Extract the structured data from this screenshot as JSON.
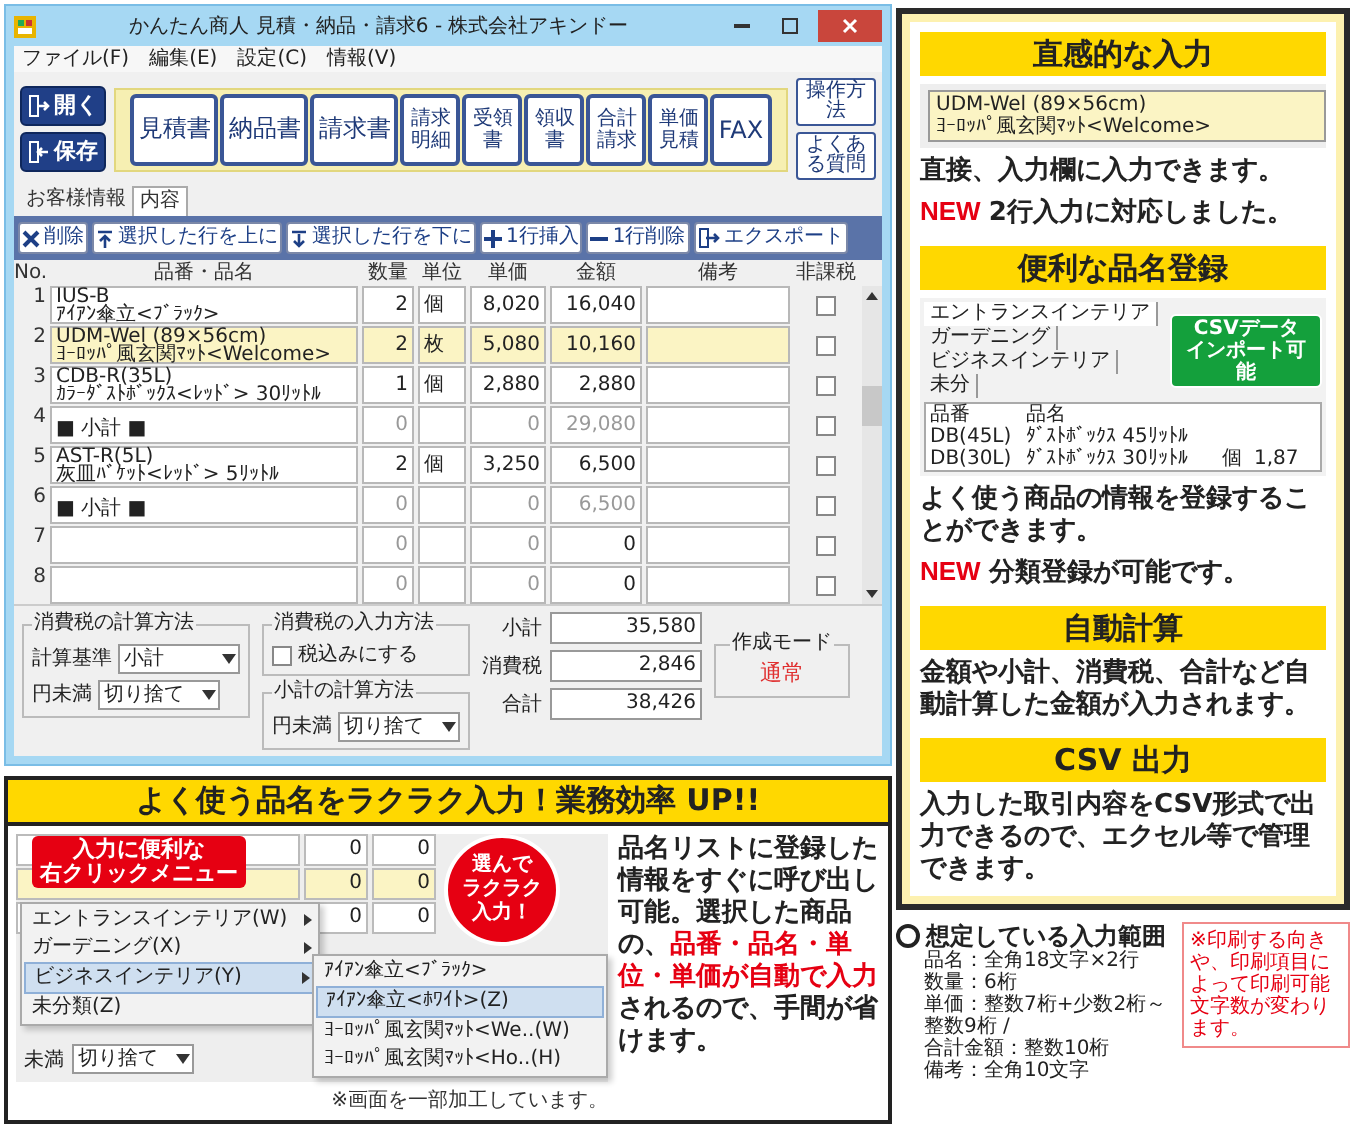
{
  "window": {
    "title": "かんたん商人 見積・納品・請求6 - 株式会社アキンドー",
    "menu": [
      "ファイル(F)",
      "編集(E)",
      "設定(C)",
      "情報(V)"
    ],
    "side_buttons": [
      "開く",
      "保存"
    ],
    "doc_buttons": [
      {
        "label": "見積書",
        "kind": "main"
      },
      {
        "label": "納品書",
        "kind": "main"
      },
      {
        "label": "請求書",
        "kind": "main"
      },
      {
        "label": "請求明細",
        "kind": "sub"
      },
      {
        "label": "受領書",
        "kind": "sub"
      },
      {
        "label": "領収書",
        "kind": "sub"
      },
      {
        "label": "合計請求",
        "kind": "sub"
      },
      {
        "label": "単価見積",
        "kind": "sub"
      },
      {
        "label": "FAX",
        "kind": "main"
      }
    ],
    "help_buttons": [
      "操作方法",
      "よくある質問"
    ],
    "tabs": [
      {
        "label": "お客様情報",
        "selected": false
      },
      {
        "label": "内容",
        "selected": true
      }
    ],
    "actions": [
      "削除",
      "選択した行を上に",
      "選択した行を下に",
      "1行挿入",
      "1行削除",
      "エクスポート"
    ],
    "table": {
      "columns": [
        "No.",
        "品番・品名",
        "数量",
        "単位",
        "単価",
        "金額",
        "備考",
        "非課税"
      ],
      "rows": [
        {
          "no": "1",
          "kind": "item",
          "lines": [
            "IUS-B",
            "ｱｲｱﾝ傘立<ﾌﾞﾗｯｸ>"
          ],
          "qty": "2",
          "unit": "個",
          "price": "8,020",
          "amount": "16,040",
          "selected": false,
          "tax_exempt": false
        },
        {
          "no": "2",
          "kind": "item",
          "lines": [
            "UDM-Wel (89×56cm)",
            "ﾖｰﾛｯﾊﾟ風玄関ﾏｯﾄ<Welcome>"
          ],
          "qty": "2",
          "unit": "枚",
          "price": "5,080",
          "amount": "10,160",
          "selected": true,
          "tax_exempt": false
        },
        {
          "no": "3",
          "kind": "item",
          "lines": [
            "CDB-R(35L)",
            "ｶﾗｰﾀﾞｽﾄﾎﾞｯｸｽ<ﾚｯﾄﾞ> 30ﾘｯﾄﾙ"
          ],
          "qty": "1",
          "unit": "個",
          "price": "2,880",
          "amount": "2,880",
          "selected": false,
          "tax_exempt": false
        },
        {
          "no": "4",
          "kind": "subtotal",
          "label": "■ 小計 ■",
          "qty": "0",
          "price": "0",
          "amount": "29,080",
          "selected": false,
          "tax_exempt": false
        },
        {
          "no": "5",
          "kind": "item",
          "lines": [
            "AST-R(5L)",
            "灰皿ﾊﾞｹｯﾄ<ﾚｯﾄﾞ> 5ﾘｯﾄﾙ"
          ],
          "qty": "2",
          "unit": "個",
          "price": "3,250",
          "amount": "6,500",
          "selected": false,
          "tax_exempt": false
        },
        {
          "no": "6",
          "kind": "subtotal",
          "label": "■ 小計 ■",
          "qty": "0",
          "price": "0",
          "amount": "6,500",
          "selected": false,
          "tax_exempt": false
        },
        {
          "no": "7",
          "kind": "empty",
          "qty": "0",
          "price": "0",
          "amount": "0",
          "selected": false,
          "tax_exempt": false
        },
        {
          "no": "8",
          "kind": "empty",
          "qty": "0",
          "price": "0",
          "amount": "0",
          "selected": false,
          "tax_exempt": false
        }
      ]
    },
    "tax_calc": {
      "title": "消費税の計算方法",
      "fields": [
        {
          "label": "計算基準",
          "value": "小計"
        },
        {
          "label": "円未満",
          "value": "切り捨て"
        }
      ]
    },
    "tax_input": {
      "title": "消費税の入力方法",
      "checkbox": {
        "label": "税込みにする",
        "checked": false
      }
    },
    "subtotal_calc": {
      "title": "小計の計算方法",
      "field": {
        "label": "円未満",
        "value": "切り捨て"
      }
    },
    "totals": [
      {
        "label": "小計",
        "value": "35,580"
      },
      {
        "label": "消費税",
        "value": "2,846"
      },
      {
        "label": "合計",
        "value": "38,426"
      }
    ],
    "mode": {
      "title": "作成モード",
      "value": "通常"
    }
  },
  "callout": {
    "title": "よく使う品名をラクラク入力！業務効率 UP!!",
    "grid_rows": [
      {
        "selected": false,
        "values": [
          "0",
          "0"
        ]
      },
      {
        "selected": true,
        "values": [
          "0",
          "0"
        ]
      },
      {
        "selected": false,
        "values": [
          "0",
          "0"
        ]
      }
    ],
    "menu_label": [
      "入力に便利な",
      "右クリックメニュー"
    ],
    "context_menu": [
      {
        "label": "エントランスインテリア(W)",
        "has_submenu": true,
        "selected": false
      },
      {
        "label": "ガーデニング(X)",
        "has_submenu": true,
        "selected": false
      },
      {
        "label": "ビジネスインテリア(Y)",
        "has_submenu": true,
        "selected": true
      },
      {
        "label": "未分類(Z)",
        "has_submenu": false,
        "selected": false
      }
    ],
    "submenu": [
      {
        "label": "ｱｲｱﾝ傘立<ﾌﾞﾗｯｸ>",
        "selected": false
      },
      {
        "label": "ｱｲｱﾝ傘立<ﾎﾜｲﾄ>(Z)",
        "selected": true
      },
      {
        "label": "ﾖｰﾛｯﾊﾟ風玄関ﾏｯﾄ<We..(W)",
        "selected": false
      },
      {
        "label": "ﾖｰﾛｯﾊﾟ風玄関ﾏｯﾄ<Ho..(H)",
        "selected": false
      }
    ],
    "bubble": [
      "選んで",
      "ラクラク",
      "入力！"
    ],
    "dropdown": {
      "label": "未満",
      "value": "切り捨て"
    },
    "note": "※画面を一部加工しています。",
    "body": "品名リストに登録した情報をすぐに呼び出し可能。選択した商品の、**品番・品名・単位・単価が自動で入力**されるので、手間が省けます。"
  },
  "features": [
    {
      "kind": "input",
      "title": "直感的な入力",
      "preview_lines": [
        "UDM-Wel (89×56cm)",
        "ﾖｰﾛｯﾊﾟ風玄関ﾏｯﾄ<Welcome>"
      ],
      "text": "直接、入力欄に入力できます。",
      "new_badge": "NEW",
      "new_text": "2行入力に対応しました。"
    },
    {
      "kind": "register",
      "title": "便利な品名登録",
      "tabs": [
        {
          "label": "エントランスインテリア",
          "selected": true
        },
        {
          "label": "ガーデニング",
          "selected": false
        },
        {
          "label": "ビジネスインテリア",
          "selected": false
        },
        {
          "label": "未分",
          "selected": false
        }
      ],
      "columns": [
        "品番",
        "品名"
      ],
      "rows": [
        [
          "DB(45L)",
          "ﾀﾞｽﾄﾎﾞｯｸｽ 45ﾘｯﾄﾙ"
        ],
        [
          "DB(30L)",
          "ﾀﾞｽﾄﾎﾞｯｸｽ 30ﾘｯﾄﾙ",
          "個",
          "1,87"
        ]
      ],
      "badge": [
        "CSVデータ",
        "インポート可能"
      ],
      "text": "よく使う商品の情報を登録することができます。",
      "new_badge": "NEW",
      "new_text": "分類登録が可能です。"
    },
    {
      "kind": "text",
      "title": "自動計算",
      "text": "金額や小計、消費税、合計など自動計算した金額が入力されます。"
    },
    {
      "kind": "text",
      "title": "CSV 出力",
      "text": "入力した取引内容をCSV形式で出力できるので、エクセル等で管理できます。"
    }
  ],
  "range": {
    "title": "想定している入力範囲",
    "items": [
      "品名：全角18文字×2行",
      "数量：6桁",
      "単価：整数7桁+少数2桁～整数9桁 /",
      "合計金額：整数10桁",
      "備考：全角10文字"
    ]
  },
  "warning": "※印刷する向きや、印刷項目によって印刷可能文字数が変わります。"
}
